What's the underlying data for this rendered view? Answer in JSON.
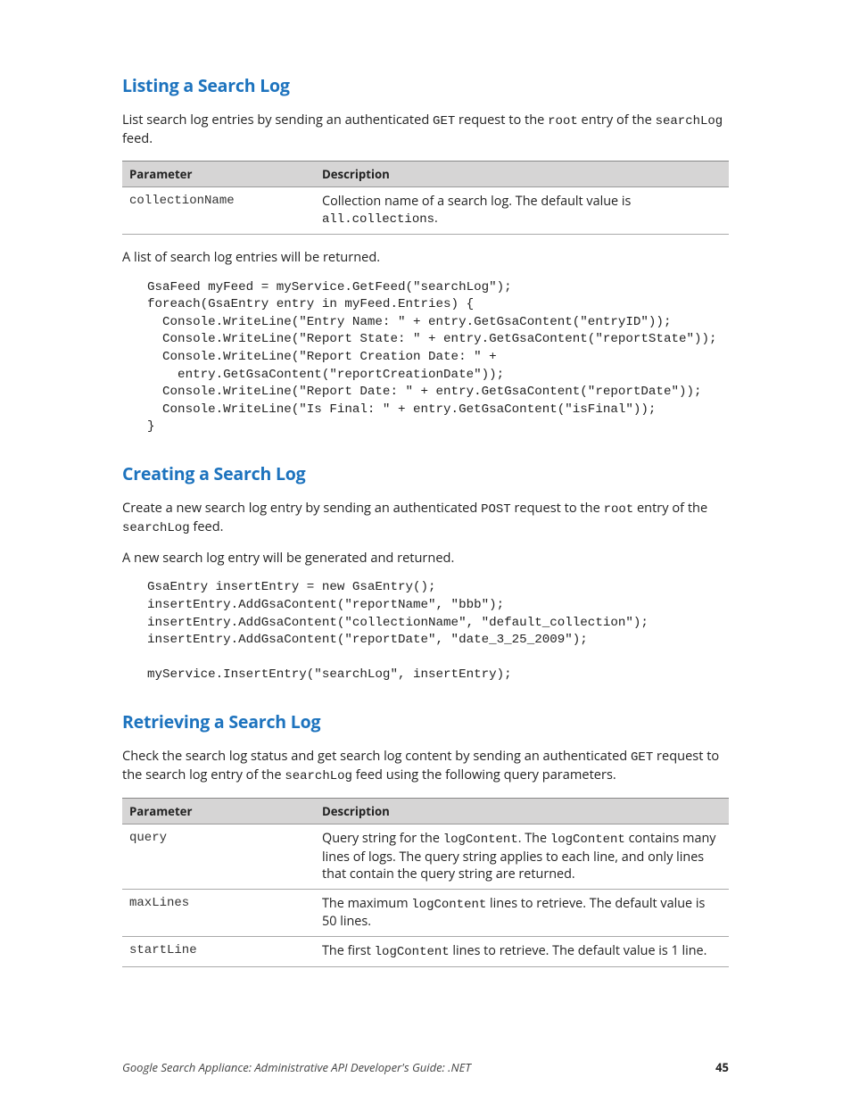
{
  "sections": {
    "listing": {
      "heading": "Listing a Search Log",
      "intro_parts": [
        "List search log entries by sending an authenticated ",
        "GET",
        " request to the ",
        "root",
        " entry of the ",
        "searchLog",
        " feed."
      ],
      "table": {
        "headers": [
          "Parameter",
          "Description"
        ],
        "rows": [
          {
            "param": "collectionName",
            "desc_parts": [
              "Collection name of a search log. The default value is ",
              "all.collections",
              "."
            ]
          }
        ]
      },
      "after_table": "A list of search log entries will be returned.",
      "code": "GsaFeed myFeed = myService.GetFeed(\"searchLog\");\nforeach(GsaEntry entry in myFeed.Entries) {\n  Console.WriteLine(\"Entry Name: \" + entry.GetGsaContent(\"entryID\"));\n  Console.WriteLine(\"Report State: \" + entry.GetGsaContent(\"reportState\"));\n  Console.WriteLine(\"Report Creation Date: \" +\n    entry.GetGsaContent(\"reportCreationDate\"));\n  Console.WriteLine(\"Report Date: \" + entry.GetGsaContent(\"reportDate\"));\n  Console.WriteLine(\"Is Final: \" + entry.GetGsaContent(\"isFinal\"));\n}"
    },
    "creating": {
      "heading": "Creating a Search Log",
      "intro_parts": [
        "Create a new search log entry by sending an authenticated ",
        "POST",
        " request to the ",
        "root",
        " entry of the ",
        "searchLog",
        " feed."
      ],
      "after_intro": "A new search log entry will be generated and returned.",
      "code": "GsaEntry insertEntry = new GsaEntry();\ninsertEntry.AddGsaContent(\"reportName\", \"bbb\");\ninsertEntry.AddGsaContent(\"collectionName\", \"default_collection\");\ninsertEntry.AddGsaContent(\"reportDate\", \"date_3_25_2009\");\n\nmyService.InsertEntry(\"searchLog\", insertEntry);"
    },
    "retrieving": {
      "heading": "Retrieving a Search Log",
      "intro_parts": [
        "Check the search log status and get search log content by sending an authenticated ",
        "GET",
        " request to the search log entry of the ",
        "searchLog",
        " feed using the following query parameters."
      ],
      "table": {
        "headers": [
          "Parameter",
          "Description"
        ],
        "rows": [
          {
            "param": "query",
            "desc_parts": [
              "Query string for the ",
              "logContent",
              ". The ",
              "logContent",
              " contains many lines of logs. The query string applies to each line, and only lines that contain the query string are returned."
            ]
          },
          {
            "param": "maxLines",
            "desc_parts": [
              "The maximum ",
              "logContent",
              " lines to retrieve. The default value is 50 lines."
            ]
          },
          {
            "param": "startLine",
            "desc_parts": [
              "The first ",
              "logContent",
              " lines to retrieve. The default value is 1 line."
            ]
          }
        ]
      }
    }
  },
  "footer": {
    "title": "Google Search Appliance: Administrative API Developer's Guide: .NET",
    "page": "45"
  }
}
